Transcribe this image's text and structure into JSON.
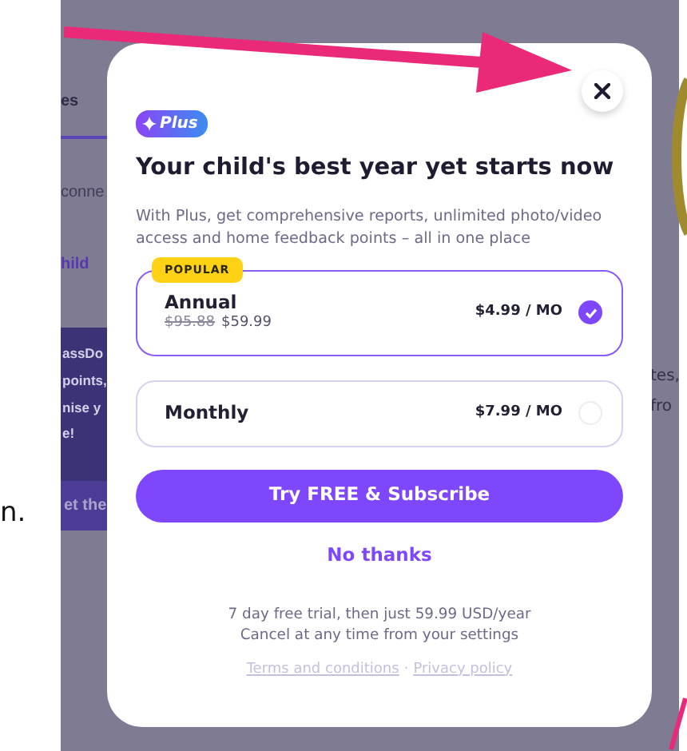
{
  "background": {
    "side_text": "n.",
    "left_texts": [
      {
        "text": "es",
        "kind": "tab"
      },
      {
        "text": "conne",
        "kind": "plain"
      },
      {
        "text": "hild",
        "kind": "link"
      }
    ],
    "banner_texts": [
      "assDo",
      "points,",
      "nise y",
      "e!"
    ],
    "banner_link": "et the",
    "right_texts": [
      "tes,",
      "fro"
    ]
  },
  "modal": {
    "badge": "Plus",
    "title": "Your child's best year yet starts now",
    "description": "With Plus, get comprehensive reports, unlimited photo/video access and home feedback points – all in one place",
    "plans": [
      {
        "badge": "POPULAR",
        "name": "Annual",
        "old_price": "$95.88",
        "price": "$59.99",
        "per_month": "$4.99 / MO",
        "selected": true
      },
      {
        "name": "Monthly",
        "per_month": "$7.99 / MO",
        "selected": false
      }
    ],
    "primary_button": "Try FREE & Subscribe",
    "secondary_button": "No thanks",
    "fine_print": [
      "7 day free trial, then just 59.99 USD/year",
      "Cancel at any time from your settings"
    ],
    "links": [
      "Terms and conditions",
      "Privacy policy"
    ],
    "links_separator": "·"
  }
}
